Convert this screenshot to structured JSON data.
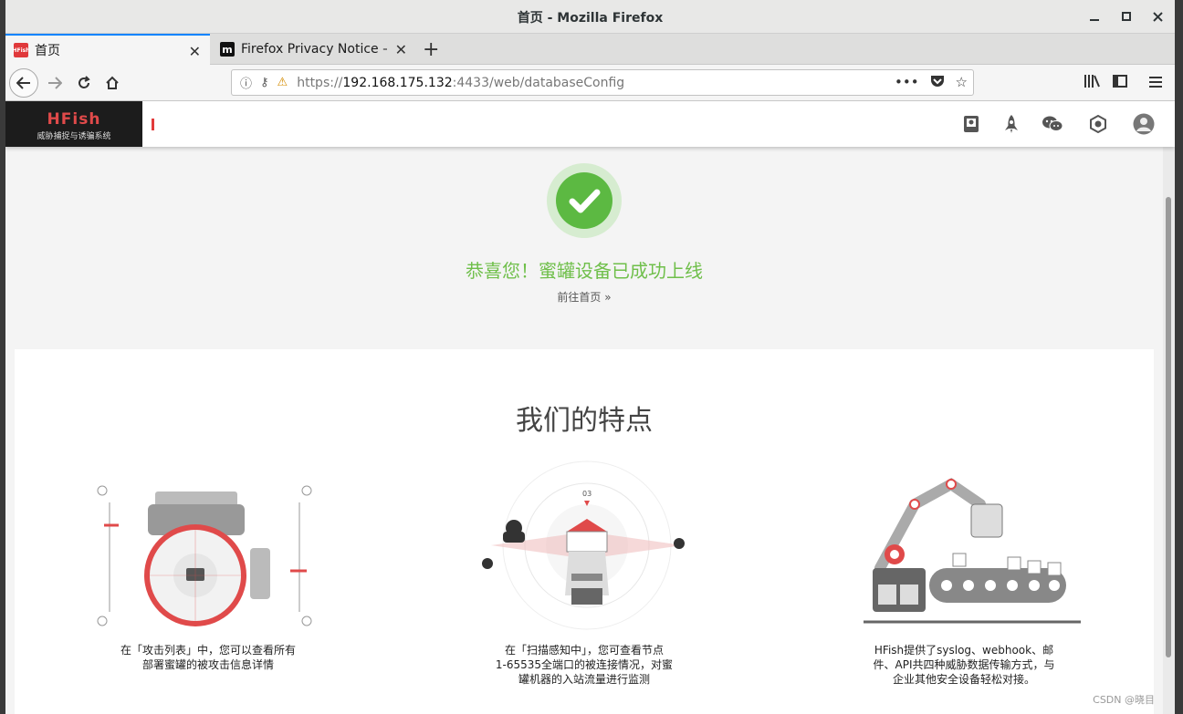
{
  "window": {
    "title": "首页 - Mozilla Firefox",
    "controls": [
      "minimize-icon",
      "maximize-icon",
      "close-icon"
    ]
  },
  "tabs": [
    {
      "label": "首页",
      "favicon_text": "HFish",
      "active": true
    },
    {
      "label": "Firefox Privacy Notice — ",
      "favicon_text": "m",
      "active": false
    }
  ],
  "navbar": {
    "url_prefix": "https://",
    "url_host": "192.168.175.132",
    "url_rest": ":4433/web/databaseConfig",
    "url_actions": [
      "more-icon",
      "pocket-icon",
      "bookmark-star-icon"
    ],
    "right_icons": [
      "library-icon",
      "sidebar-icon",
      "menu-icon"
    ]
  },
  "app_header": {
    "logo_main": "HFish",
    "logo_sub": "威胁捕捉与诱骗系统",
    "icons": [
      "notebook-icon",
      "rocket-icon",
      "wechat-icon",
      "hexagon-icon",
      "user-avatar-icon"
    ]
  },
  "success": {
    "message": "恭喜您！蜜罐设备已成功上线",
    "link": "前往首页"
  },
  "features": {
    "title": "我们的特点",
    "items": [
      {
        "text_line1": "在「攻击列表」中，您可以查看所有",
        "text_line2": "部署蜜罐的被攻击信息详情",
        "text_line3": ""
      },
      {
        "text_line1": "在「扫描感知中」，您可查看节点",
        "text_line2": "1-65535全端口的被连接情况，对蜜",
        "text_line3": "罐机器的入站流量进行监测"
      },
      {
        "text_line1": "HFish提供了syslog、webhook、邮",
        "text_line2": "件、API共四种威胁数据传输方式，与",
        "text_line3": "企业其他安全设备轻松对接。"
      }
    ],
    "illustration_labels": {
      "radar_count": "03"
    }
  },
  "watermark": "CSDN @晓目"
}
